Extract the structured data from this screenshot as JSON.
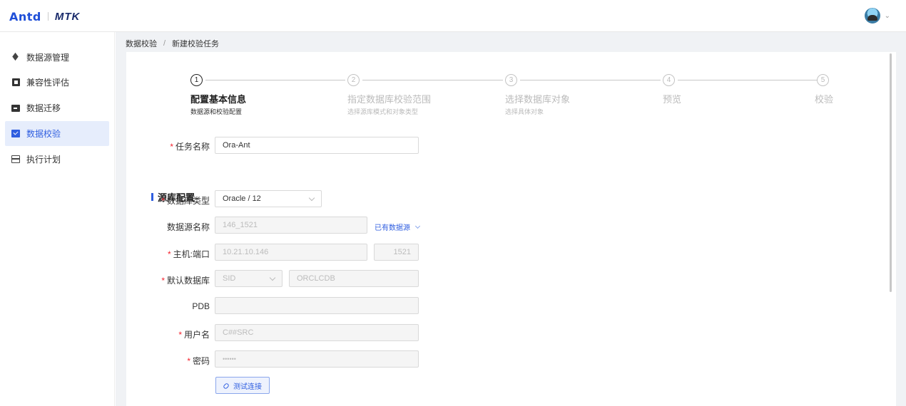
{
  "header": {
    "logo_primary": "Antd",
    "logo_secondary": "MTK",
    "user_menu_icon": "chevron-down-icon"
  },
  "sidebar": {
    "items": [
      {
        "label": "数据源管理",
        "icon": "layers-icon",
        "active": false
      },
      {
        "label": "兼容性评估",
        "icon": "assessment-icon",
        "active": false
      },
      {
        "label": "数据迁移",
        "icon": "migrate-folder-icon",
        "active": false
      },
      {
        "label": "数据校验",
        "icon": "verify-icon",
        "active": true
      },
      {
        "label": "执行计划",
        "icon": "calendar-icon",
        "active": false
      }
    ]
  },
  "breadcrumb": {
    "items": [
      "数据校验",
      "新建校验任务"
    ],
    "separator": "/"
  },
  "steps": [
    {
      "number": "1",
      "title": "配置基本信息",
      "desc": "数据源和校验配置",
      "active": true
    },
    {
      "number": "2",
      "title": "指定数据库校验范围",
      "desc": "选择源库模式和对象类型",
      "active": false
    },
    {
      "number": "3",
      "title": "选择数据库对象",
      "desc": "选择具体对象",
      "active": false
    },
    {
      "number": "4",
      "title": "预览",
      "desc": "",
      "active": false
    },
    {
      "number": "5",
      "title": "校验",
      "desc": "",
      "active": false
    }
  ],
  "form": {
    "task_name": {
      "label": "任务名称",
      "required": "*",
      "value": "Ora-Ant"
    },
    "section_title": "源库配置",
    "db_type": {
      "label": "数据库类型",
      "required": "*",
      "value": "Oracle / 12"
    },
    "datasource_name": {
      "label": "数据源名称",
      "value": "146_1521",
      "link": "已有数据源"
    },
    "host_port": {
      "label": "主机:端口",
      "required": "*",
      "host": "10.21.10.146",
      "port": "1521"
    },
    "default_db": {
      "label": "默认数据库",
      "required": "*",
      "type": "SID",
      "value": "ORCLCDB"
    },
    "pdb": {
      "label": "PDB",
      "value": ""
    },
    "username": {
      "label": "用户名",
      "required": "*",
      "value": "C##SRC"
    },
    "password": {
      "label": "密码",
      "required": "*",
      "value": "••••••"
    },
    "test_button": "测试连接"
  },
  "colors": {
    "accent": "#2f5ee0",
    "active_menu_bg": "#e6edfc",
    "required": "#f5222d",
    "page_bg": "#f0f2f5"
  }
}
